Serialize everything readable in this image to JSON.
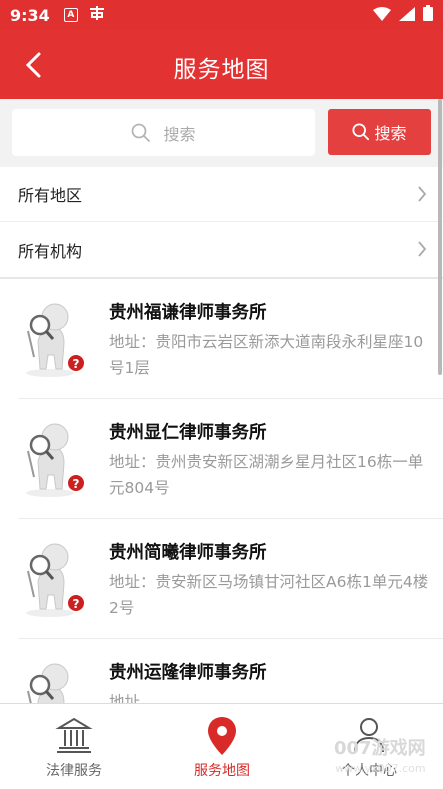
{
  "status_bar": {
    "time": "9:34",
    "icon_a": "A"
  },
  "header": {
    "title": "服务地图"
  },
  "search": {
    "placeholder": "搜索",
    "button_label": "搜索"
  },
  "filters": [
    {
      "label": "所有地区"
    },
    {
      "label": "所有机构"
    }
  ],
  "firms": [
    {
      "name": "贵州福谦律师事务所",
      "address": "地址：贵阳市云岩区新添大道南段永利星座10号1层"
    },
    {
      "name": "贵州显仁律师事务所",
      "address": "地址：贵州贵安新区湖潮乡星月社区16栋一单元804号"
    },
    {
      "name": "贵州简曦律师事务所",
      "address": "地址：贵安新区马场镇甘河社区A6栋1单元4楼2号"
    },
    {
      "name": "贵州运隆律师事务所",
      "address": "地址"
    }
  ],
  "tabs": [
    {
      "label": "法律服务",
      "icon": "courthouse-icon"
    },
    {
      "label": "服务地图",
      "icon": "map-pin-icon"
    },
    {
      "label": "个人中心",
      "icon": "person-icon"
    }
  ],
  "watermark": {
    "main": "007游戏网",
    "sub": "www.yx007.com"
  },
  "colors": {
    "brand": "#e33232",
    "tab_active": "#d92a2a",
    "muted": "#9a9a9a"
  }
}
